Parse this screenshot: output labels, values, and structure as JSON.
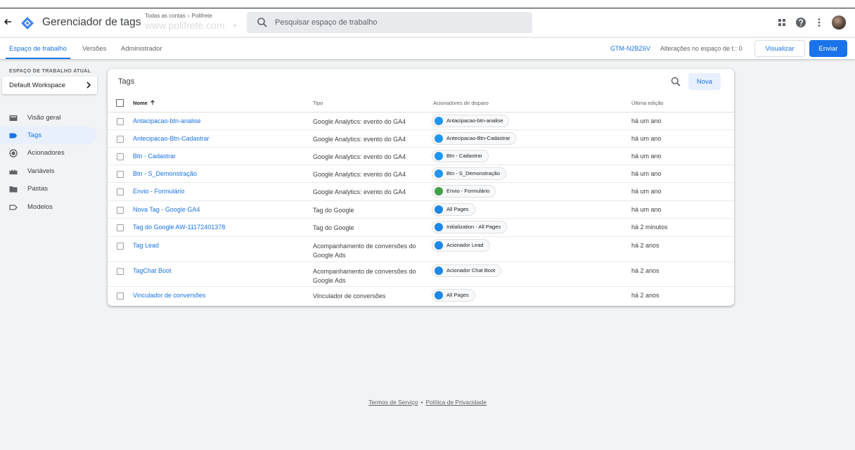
{
  "header": {
    "app_title": "Gerenciador de tags",
    "breadcrumb": {
      "root": "Todas as contas",
      "account": "Polifrete"
    },
    "container": "www.polifrete.com",
    "search_placeholder": "Pesquisar espaço de trabalho"
  },
  "subnav": {
    "tabs": [
      {
        "label": "Espaço de trabalho"
      },
      {
        "label": "Versões"
      },
      {
        "label": "Administrador"
      }
    ],
    "container_id": "GTM-N2BZ6V",
    "changes": "Alterações no espaço de t.: 0",
    "preview_label": "Visualizar",
    "submit_label": "Enviar"
  },
  "sidebar": {
    "heading": "ESPAÇO DE TRABALHO ATUAL",
    "workspace": "Default Workspace",
    "items": [
      {
        "label": "Visão geral",
        "icon": "overview-icon"
      },
      {
        "label": "Tags",
        "icon": "tag-icon"
      },
      {
        "label": "Acionadores",
        "icon": "trigger-icon"
      },
      {
        "label": "Variáveis",
        "icon": "variable-icon"
      },
      {
        "label": "Pastas",
        "icon": "folder-icon"
      },
      {
        "label": "Modelos",
        "icon": "template-icon"
      }
    ]
  },
  "main": {
    "title": "Tags",
    "new_label": "Nova",
    "columns": {
      "name": "Nome",
      "type": "Tipo",
      "trigger": "Acionadores de disparo",
      "edited": "Última edição"
    },
    "rows": [
      {
        "name": "Antacipacao-btn-analise",
        "type": "Google Analytics: evento do GA4",
        "trigger": "Antacipacao-btn-analise",
        "trigger_icon": "link-icon",
        "edited": "há um ano"
      },
      {
        "name": "Antecipacao-Btn-Cadastrar",
        "type": "Google Analytics: evento do GA4",
        "trigger": "Antecipacao-Btn-Cadastrar",
        "trigger_icon": "link-icon",
        "edited": "há um ano"
      },
      {
        "name": "Btn - Cadastrar",
        "type": "Google Analytics: evento do GA4",
        "trigger": "Btn - Cadastrar",
        "trigger_icon": "link-icon",
        "edited": "há um ano"
      },
      {
        "name": "Btn - S_Demonstração",
        "type": "Google Analytics: evento do GA4",
        "trigger": "Btn - S_Demonstração",
        "trigger_icon": "link-icon",
        "edited": "há um ano"
      },
      {
        "name": "Envio - Formulário",
        "type": "Google Analytics: evento do GA4",
        "trigger": "Envio - Formulário",
        "trigger_icon": "form-icon",
        "edited": "há um ano"
      },
      {
        "name": "Nova Tag - Google GA4",
        "type": "Tag do Google",
        "trigger": "All Pages",
        "trigger_icon": "eye-icon",
        "edited": "há um ano"
      },
      {
        "name": "Tag do Google AW-11172401378",
        "type": "Tag do Google",
        "trigger": "Initialization - All Pages",
        "trigger_icon": "power-icon",
        "edited": "há 2 minutos"
      },
      {
        "name": "Tag Lead",
        "type": "Acompanhamento de conversões do Google Ads",
        "trigger": "Acionador Lead",
        "trigger_icon": "eye-icon",
        "edited": "há 2 anos"
      },
      {
        "name": "TagChat Boot",
        "type": "Acompanhamento de conversões do Google Ads",
        "trigger": "Acionador Chat Boot",
        "trigger_icon": "click-icon",
        "edited": "há 2 anos"
      },
      {
        "name": "Vinculador de conversões",
        "type": "Vinculador de conversões",
        "trigger": "All Pages",
        "trigger_icon": "eye-icon",
        "edited": "há 2 anos"
      }
    ]
  },
  "footer": {
    "terms": "Termos de Serviço",
    "separator": "•",
    "privacy": "Política de Privacidade"
  },
  "colors": {
    "accent": "#1a73e8",
    "logo": "#4285f4",
    "trigger_blue": "#1e88e5",
    "trigger_green": "#43a047"
  }
}
